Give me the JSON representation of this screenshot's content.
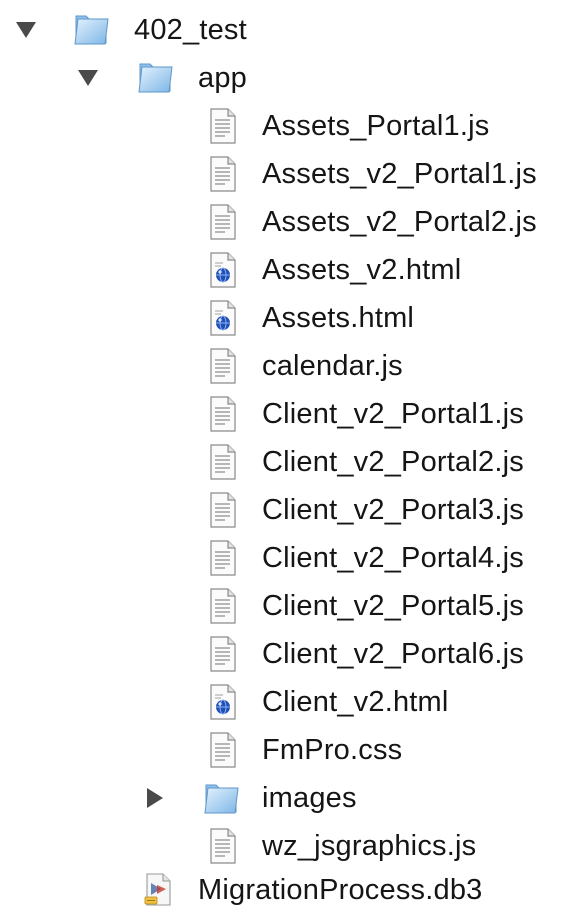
{
  "tree": {
    "root": {
      "label": "402_test",
      "expanded": true,
      "icon": "folder-icon"
    },
    "app_folder": {
      "label": "app",
      "expanded": true,
      "icon": "folder-icon"
    },
    "app_items": [
      {
        "label": "Assets_Portal1.js",
        "type": "text-file",
        "icon": "text-document-icon"
      },
      {
        "label": "Assets_v2_Portal1.js",
        "type": "text-file",
        "icon": "text-document-icon"
      },
      {
        "label": "Assets_v2_Portal2.js",
        "type": "text-file",
        "icon": "text-document-icon"
      },
      {
        "label": "Assets_v2.html",
        "type": "html-file",
        "icon": "html-document-icon"
      },
      {
        "label": "Assets.html",
        "type": "html-file",
        "icon": "html-document-icon"
      },
      {
        "label": "calendar.js",
        "type": "text-file",
        "icon": "text-document-icon"
      },
      {
        "label": "Client_v2_Portal1.js",
        "type": "text-file",
        "icon": "text-document-icon"
      },
      {
        "label": "Client_v2_Portal2.js",
        "type": "text-file",
        "icon": "text-document-icon"
      },
      {
        "label": "Client_v2_Portal3.js",
        "type": "text-file",
        "icon": "text-document-icon"
      },
      {
        "label": "Client_v2_Portal4.js",
        "type": "text-file",
        "icon": "text-document-icon"
      },
      {
        "label": "Client_v2_Portal5.js",
        "type": "text-file",
        "icon": "text-document-icon"
      },
      {
        "label": "Client_v2_Portal6.js",
        "type": "text-file",
        "icon": "text-document-icon"
      },
      {
        "label": "Client_v2.html",
        "type": "html-file",
        "icon": "html-document-icon"
      },
      {
        "label": "FmPro.css",
        "type": "text-file",
        "icon": "text-document-icon"
      },
      {
        "label": "images",
        "type": "folder",
        "expanded": false,
        "icon": "folder-icon"
      },
      {
        "label": "wz_jsgraphics.js",
        "type": "text-file",
        "icon": "text-document-icon"
      }
    ],
    "root_items": [
      {
        "label": "MigrationProcess.db3",
        "type": "database-file",
        "icon": "database-document-icon"
      }
    ]
  },
  "colors": {
    "background": "#ffffff",
    "text": "#151515",
    "disclosure": "#4a4a4a",
    "folder_light": "#cfe6fb",
    "folder_dark": "#6aa9df",
    "html_badge": "#1f4fb8"
  }
}
